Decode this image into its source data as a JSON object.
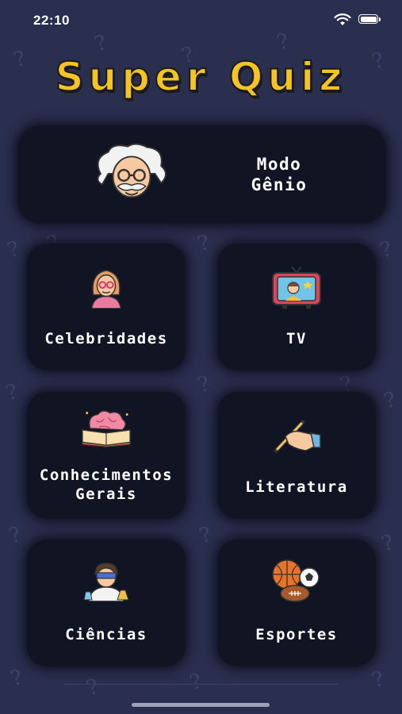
{
  "status_bar": {
    "time": "22:10"
  },
  "app": {
    "title": "Super Quiz"
  },
  "genius_mode": {
    "label_line1": "Modo",
    "label_line2": "Gênio"
  },
  "categories": [
    {
      "label": "Celebridades",
      "icon": "celebrity-woman-icon"
    },
    {
      "label": "TV",
      "icon": "tv-icon"
    },
    {
      "label_line1": "Conhecimentos",
      "label_line2": "Gerais",
      "icon": "brain-book-icon"
    },
    {
      "label": "Literatura",
      "icon": "writing-hand-icon"
    },
    {
      "label": "Ciências",
      "icon": "scientist-icon"
    },
    {
      "label": "Esportes",
      "icon": "sports-balls-icon"
    }
  ],
  "colors": {
    "background": "#2b2f4f",
    "card": "#111422",
    "title": "#f5c423"
  }
}
